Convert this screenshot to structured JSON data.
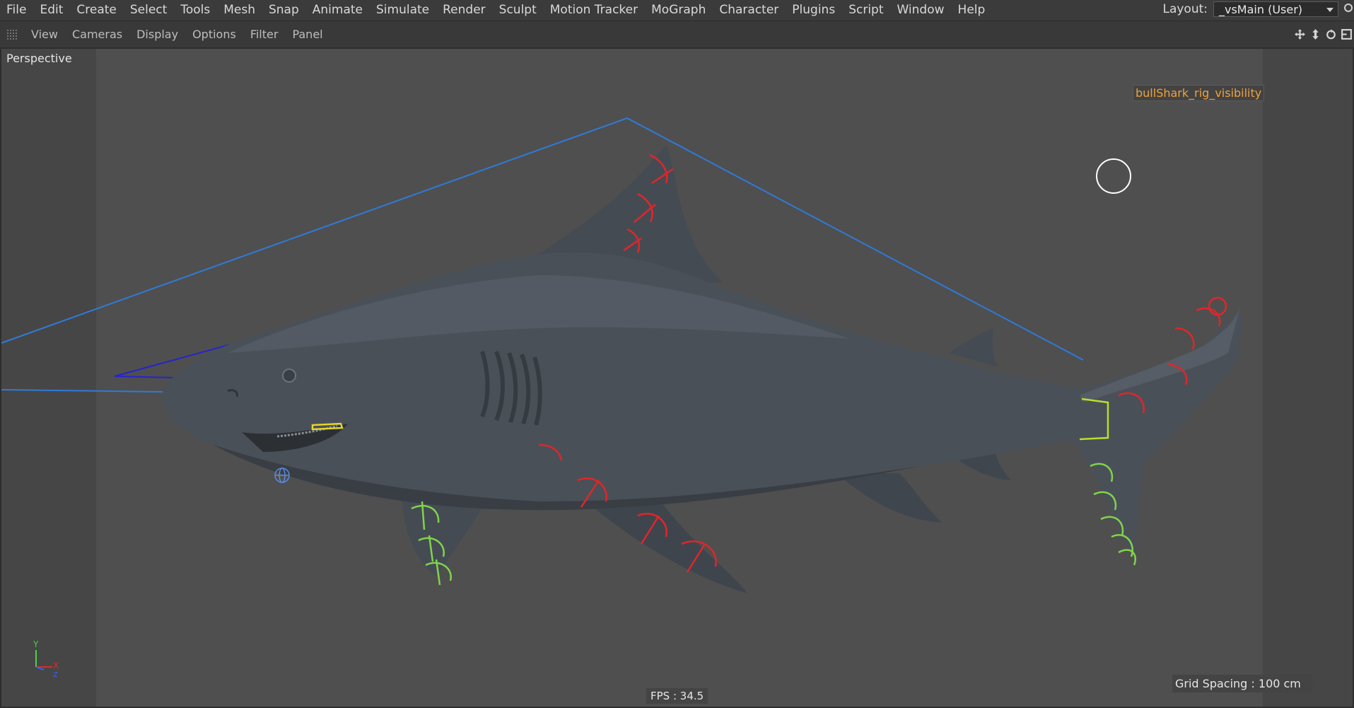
{
  "menubar": {
    "items": [
      "File",
      "Edit",
      "Create",
      "Select",
      "Tools",
      "Mesh",
      "Snap",
      "Animate",
      "Simulate",
      "Render",
      "Sculpt",
      "Motion Tracker",
      "MoGraph",
      "Character",
      "Plugins",
      "Script",
      "Window",
      "Help"
    ],
    "layout_label": "Layout:",
    "layout_value": "_vsMain (User)"
  },
  "viewbar": {
    "items": [
      "View",
      "Cameras",
      "Display",
      "Options",
      "Filter",
      "Panel"
    ],
    "nav_icons": [
      "move-view-icon",
      "dolly-view-icon",
      "rotate-view-icon",
      "maximize-view-icon"
    ]
  },
  "viewport": {
    "camera_label": "Perspective",
    "rig_tag": "bullShark_rig_visibility",
    "fps": "FPS : 34.5",
    "grid_spacing": "Grid Spacing : 100 cm",
    "axis_labels": {
      "y": "Y",
      "x": "X",
      "z": "Z"
    }
  },
  "colors": {
    "background": "#4f4f4f",
    "shark": "#4a5058",
    "rig_red": "#e0262a",
    "rig_green": "#7fd44b",
    "rig_blue": "#2f6fd6",
    "rig_tag": "#f0a23a"
  }
}
